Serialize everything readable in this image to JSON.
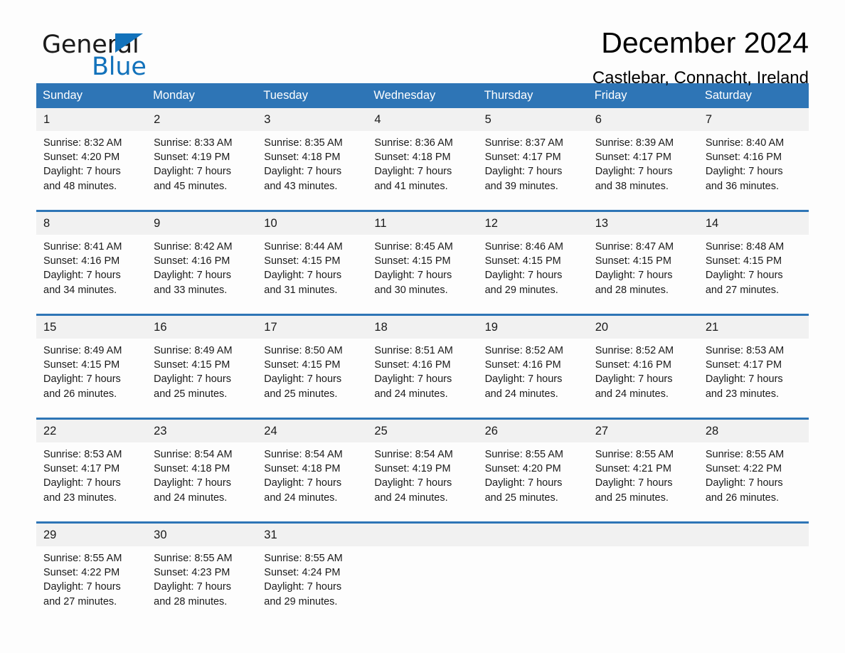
{
  "brand": {
    "name_part1": "General",
    "name_part2": "Blue",
    "triangle_color": "#1272bb"
  },
  "header": {
    "title": "December 2024",
    "subtitle": "Castlebar, Connacht, Ireland",
    "accent_color": "#2e75b6",
    "daynum_band_color": "#f1f1f1"
  },
  "weekday_headers": [
    "Sunday",
    "Monday",
    "Tuesday",
    "Wednesday",
    "Thursday",
    "Friday",
    "Saturday"
  ],
  "labels": {
    "sunrise_prefix": "Sunrise:",
    "sunset_prefix": "Sunset:",
    "daylight_prefix": "Daylight:"
  },
  "weeks": [
    [
      {
        "day": "1",
        "sunrise": "Sunrise: 8:32 AM",
        "sunset": "Sunset: 4:20 PM",
        "daylight_line1": "Daylight: 7 hours",
        "daylight_line2": "and 48 minutes."
      },
      {
        "day": "2",
        "sunrise": "Sunrise: 8:33 AM",
        "sunset": "Sunset: 4:19 PM",
        "daylight_line1": "Daylight: 7 hours",
        "daylight_line2": "and 45 minutes."
      },
      {
        "day": "3",
        "sunrise": "Sunrise: 8:35 AM",
        "sunset": "Sunset: 4:18 PM",
        "daylight_line1": "Daylight: 7 hours",
        "daylight_line2": "and 43 minutes."
      },
      {
        "day": "4",
        "sunrise": "Sunrise: 8:36 AM",
        "sunset": "Sunset: 4:18 PM",
        "daylight_line1": "Daylight: 7 hours",
        "daylight_line2": "and 41 minutes."
      },
      {
        "day": "5",
        "sunrise": "Sunrise: 8:37 AM",
        "sunset": "Sunset: 4:17 PM",
        "daylight_line1": "Daylight: 7 hours",
        "daylight_line2": "and 39 minutes."
      },
      {
        "day": "6",
        "sunrise": "Sunrise: 8:39 AM",
        "sunset": "Sunset: 4:17 PM",
        "daylight_line1": "Daylight: 7 hours",
        "daylight_line2": "and 38 minutes."
      },
      {
        "day": "7",
        "sunrise": "Sunrise: 8:40 AM",
        "sunset": "Sunset: 4:16 PM",
        "daylight_line1": "Daylight: 7 hours",
        "daylight_line2": "and 36 minutes."
      }
    ],
    [
      {
        "day": "8",
        "sunrise": "Sunrise: 8:41 AM",
        "sunset": "Sunset: 4:16 PM",
        "daylight_line1": "Daylight: 7 hours",
        "daylight_line2": "and 34 minutes."
      },
      {
        "day": "9",
        "sunrise": "Sunrise: 8:42 AM",
        "sunset": "Sunset: 4:16 PM",
        "daylight_line1": "Daylight: 7 hours",
        "daylight_line2": "and 33 minutes."
      },
      {
        "day": "10",
        "sunrise": "Sunrise: 8:44 AM",
        "sunset": "Sunset: 4:15 PM",
        "daylight_line1": "Daylight: 7 hours",
        "daylight_line2": "and 31 minutes."
      },
      {
        "day": "11",
        "sunrise": "Sunrise: 8:45 AM",
        "sunset": "Sunset: 4:15 PM",
        "daylight_line1": "Daylight: 7 hours",
        "daylight_line2": "and 30 minutes."
      },
      {
        "day": "12",
        "sunrise": "Sunrise: 8:46 AM",
        "sunset": "Sunset: 4:15 PM",
        "daylight_line1": "Daylight: 7 hours",
        "daylight_line2": "and 29 minutes."
      },
      {
        "day": "13",
        "sunrise": "Sunrise: 8:47 AM",
        "sunset": "Sunset: 4:15 PM",
        "daylight_line1": "Daylight: 7 hours",
        "daylight_line2": "and 28 minutes."
      },
      {
        "day": "14",
        "sunrise": "Sunrise: 8:48 AM",
        "sunset": "Sunset: 4:15 PM",
        "daylight_line1": "Daylight: 7 hours",
        "daylight_line2": "and 27 minutes."
      }
    ],
    [
      {
        "day": "15",
        "sunrise": "Sunrise: 8:49 AM",
        "sunset": "Sunset: 4:15 PM",
        "daylight_line1": "Daylight: 7 hours",
        "daylight_line2": "and 26 minutes."
      },
      {
        "day": "16",
        "sunrise": "Sunrise: 8:49 AM",
        "sunset": "Sunset: 4:15 PM",
        "daylight_line1": "Daylight: 7 hours",
        "daylight_line2": "and 25 minutes."
      },
      {
        "day": "17",
        "sunrise": "Sunrise: 8:50 AM",
        "sunset": "Sunset: 4:15 PM",
        "daylight_line1": "Daylight: 7 hours",
        "daylight_line2": "and 25 minutes."
      },
      {
        "day": "18",
        "sunrise": "Sunrise: 8:51 AM",
        "sunset": "Sunset: 4:16 PM",
        "daylight_line1": "Daylight: 7 hours",
        "daylight_line2": "and 24 minutes."
      },
      {
        "day": "19",
        "sunrise": "Sunrise: 8:52 AM",
        "sunset": "Sunset: 4:16 PM",
        "daylight_line1": "Daylight: 7 hours",
        "daylight_line2": "and 24 minutes."
      },
      {
        "day": "20",
        "sunrise": "Sunrise: 8:52 AM",
        "sunset": "Sunset: 4:16 PM",
        "daylight_line1": "Daylight: 7 hours",
        "daylight_line2": "and 24 minutes."
      },
      {
        "day": "21",
        "sunrise": "Sunrise: 8:53 AM",
        "sunset": "Sunset: 4:17 PM",
        "daylight_line1": "Daylight: 7 hours",
        "daylight_line2": "and 23 minutes."
      }
    ],
    [
      {
        "day": "22",
        "sunrise": "Sunrise: 8:53 AM",
        "sunset": "Sunset: 4:17 PM",
        "daylight_line1": "Daylight: 7 hours",
        "daylight_line2": "and 23 minutes."
      },
      {
        "day": "23",
        "sunrise": "Sunrise: 8:54 AM",
        "sunset": "Sunset: 4:18 PM",
        "daylight_line1": "Daylight: 7 hours",
        "daylight_line2": "and 24 minutes."
      },
      {
        "day": "24",
        "sunrise": "Sunrise: 8:54 AM",
        "sunset": "Sunset: 4:18 PM",
        "daylight_line1": "Daylight: 7 hours",
        "daylight_line2": "and 24 minutes."
      },
      {
        "day": "25",
        "sunrise": "Sunrise: 8:54 AM",
        "sunset": "Sunset: 4:19 PM",
        "daylight_line1": "Daylight: 7 hours",
        "daylight_line2": "and 24 minutes."
      },
      {
        "day": "26",
        "sunrise": "Sunrise: 8:55 AM",
        "sunset": "Sunset: 4:20 PM",
        "daylight_line1": "Daylight: 7 hours",
        "daylight_line2": "and 25 minutes."
      },
      {
        "day": "27",
        "sunrise": "Sunrise: 8:55 AM",
        "sunset": "Sunset: 4:21 PM",
        "daylight_line1": "Daylight: 7 hours",
        "daylight_line2": "and 25 minutes."
      },
      {
        "day": "28",
        "sunrise": "Sunrise: 8:55 AM",
        "sunset": "Sunset: 4:22 PM",
        "daylight_line1": "Daylight: 7 hours",
        "daylight_line2": "and 26 minutes."
      }
    ],
    [
      {
        "day": "29",
        "sunrise": "Sunrise: 8:55 AM",
        "sunset": "Sunset: 4:22 PM",
        "daylight_line1": "Daylight: 7 hours",
        "daylight_line2": "and 27 minutes."
      },
      {
        "day": "30",
        "sunrise": "Sunrise: 8:55 AM",
        "sunset": "Sunset: 4:23 PM",
        "daylight_line1": "Daylight: 7 hours",
        "daylight_line2": "and 28 minutes."
      },
      {
        "day": "31",
        "sunrise": "Sunrise: 8:55 AM",
        "sunset": "Sunset: 4:24 PM",
        "daylight_line1": "Daylight: 7 hours",
        "daylight_line2": "and 29 minutes."
      },
      {
        "day": "",
        "sunrise": "",
        "sunset": "",
        "daylight_line1": "",
        "daylight_line2": ""
      },
      {
        "day": "",
        "sunrise": "",
        "sunset": "",
        "daylight_line1": "",
        "daylight_line2": ""
      },
      {
        "day": "",
        "sunrise": "",
        "sunset": "",
        "daylight_line1": "",
        "daylight_line2": ""
      },
      {
        "day": "",
        "sunrise": "",
        "sunset": "",
        "daylight_line1": "",
        "daylight_line2": ""
      }
    ]
  ]
}
